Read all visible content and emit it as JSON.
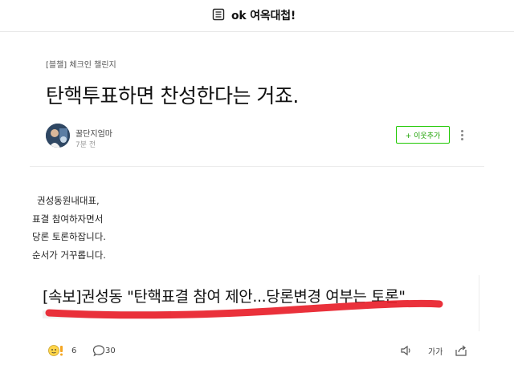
{
  "header": {
    "title": "ok 여옥대첩!",
    "menu_icon": "list-icon"
  },
  "post": {
    "category": "[블챌] 체크인 챌린지",
    "title": "탄핵투표하면 찬성한다는 거죠.",
    "author": "꿀단지엄마",
    "time": "7분 전",
    "follow_label": "+ 이웃추가",
    "body_lines": [
      "권성동원내대표,",
      "표결 참여하자면서",
      "당론 토론하잡니다.",
      "순서가 거꾸롭니다."
    ]
  },
  "scrap": {
    "headline": "[속보]권성동 \"탄핵표결 참여 제안...당론변경 여부는 토론\"",
    "underline_color": "#e8202a"
  },
  "footer": {
    "reaction_count": "6",
    "comment_count": "30",
    "font_label": "가가"
  }
}
